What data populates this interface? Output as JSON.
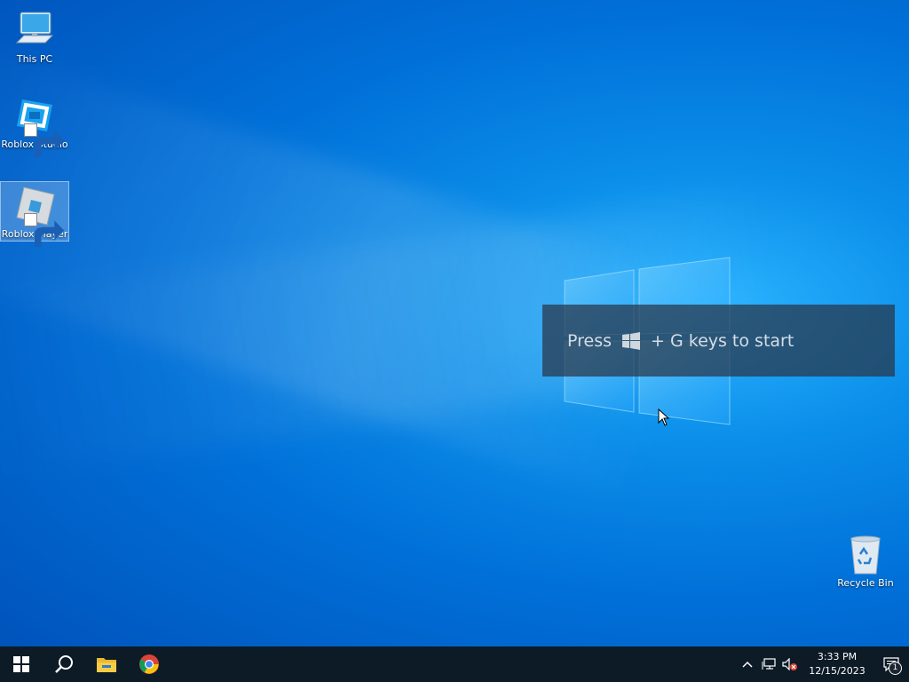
{
  "desktop": {
    "icons": [
      {
        "label": "This PC",
        "icon": "this-pc-icon",
        "selected": false
      },
      {
        "label": "Roblox Studio",
        "icon": "roblox-studio-icon",
        "selected": false
      },
      {
        "label": "Roblox Player",
        "icon": "roblox-player-icon",
        "selected": true
      },
      {
        "label": "Recycle Bin",
        "icon": "recycle-bin-icon",
        "selected": false
      }
    ]
  },
  "toast": {
    "prefix": "Press",
    "suffix": "+ G keys to start"
  },
  "taskbar": {
    "pinned": [
      "start-icon",
      "search-icon",
      "file-explorer-icon",
      "chrome-icon"
    ],
    "tray": {
      "icons": [
        "show-hidden-icons",
        "network-icon",
        "volume-muted-icon"
      ],
      "time": "3:33 PM",
      "date": "12/15/2023",
      "notification_count": "1"
    }
  },
  "colors": {
    "taskbar": "#0d1b27",
    "wallpaper_accent": "#0b8fea"
  }
}
